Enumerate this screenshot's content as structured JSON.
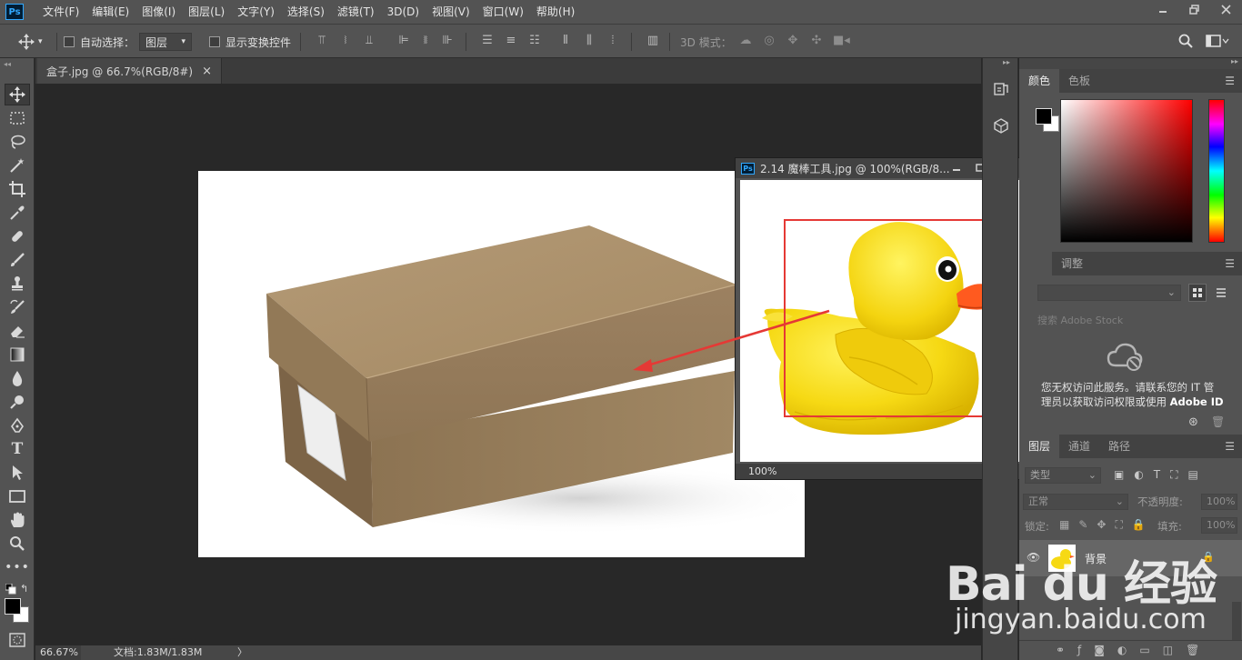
{
  "menubar": {
    "logo": "Ps",
    "items": [
      "文件(F)",
      "编辑(E)",
      "图像(I)",
      "图层(L)",
      "文字(Y)",
      "选择(S)",
      "滤镜(T)",
      "3D(D)",
      "视图(V)",
      "窗口(W)",
      "帮助(H)"
    ],
    "window_controls": [
      "minimize",
      "restore",
      "close"
    ]
  },
  "options": {
    "auto_select_label": "自动选择：",
    "auto_select_value": "图层",
    "show_transform_label": "显示变换控件",
    "mode_3d_label": "3D 模式："
  },
  "document": {
    "tab_label": "盒子.jpg @ 66.7%(RGB/8#)",
    "tab_close": "×"
  },
  "floating_window": {
    "logo": "Ps",
    "title": "2.14 魔棒工具.jpg @ 100%(RGB/8...",
    "zoom": "100%"
  },
  "statusbar": {
    "zoom": "66.67%",
    "doc_info": "文档:1.83M/1.83M",
    "arrow": "〉"
  },
  "panels": {
    "color_tabs": [
      "颜色",
      "色板"
    ],
    "adjust_tab": "调整",
    "stock_search_placeholder": "搜索 Adobe Stock",
    "stock_message_1": "您无权访问此服务。请联系您的 IT 管",
    "stock_message_2": "理员以获取访问权限或使用",
    "stock_message_3": "Adobe ID",
    "layer_tabs": [
      "图层",
      "通道",
      "路径"
    ],
    "layer_filter": "类型",
    "blend_mode": "正常",
    "opacity_label": "不透明度:",
    "opacity_value": "100%",
    "lock_label": "锁定:",
    "fill_label": "填充:",
    "fill_value": "100%",
    "layer_name": "背景"
  },
  "watermark": {
    "brand": "Bai du 经验",
    "url": "jingyan.baidu.com"
  },
  "colors": {
    "ui_dark": "#282828",
    "ui_panel": "#535353",
    "ps_blue": "#31a8ff",
    "annotation_red": "#e53935",
    "duck_yellow": "#f7dc1c",
    "box_brown": "#a38a66"
  }
}
